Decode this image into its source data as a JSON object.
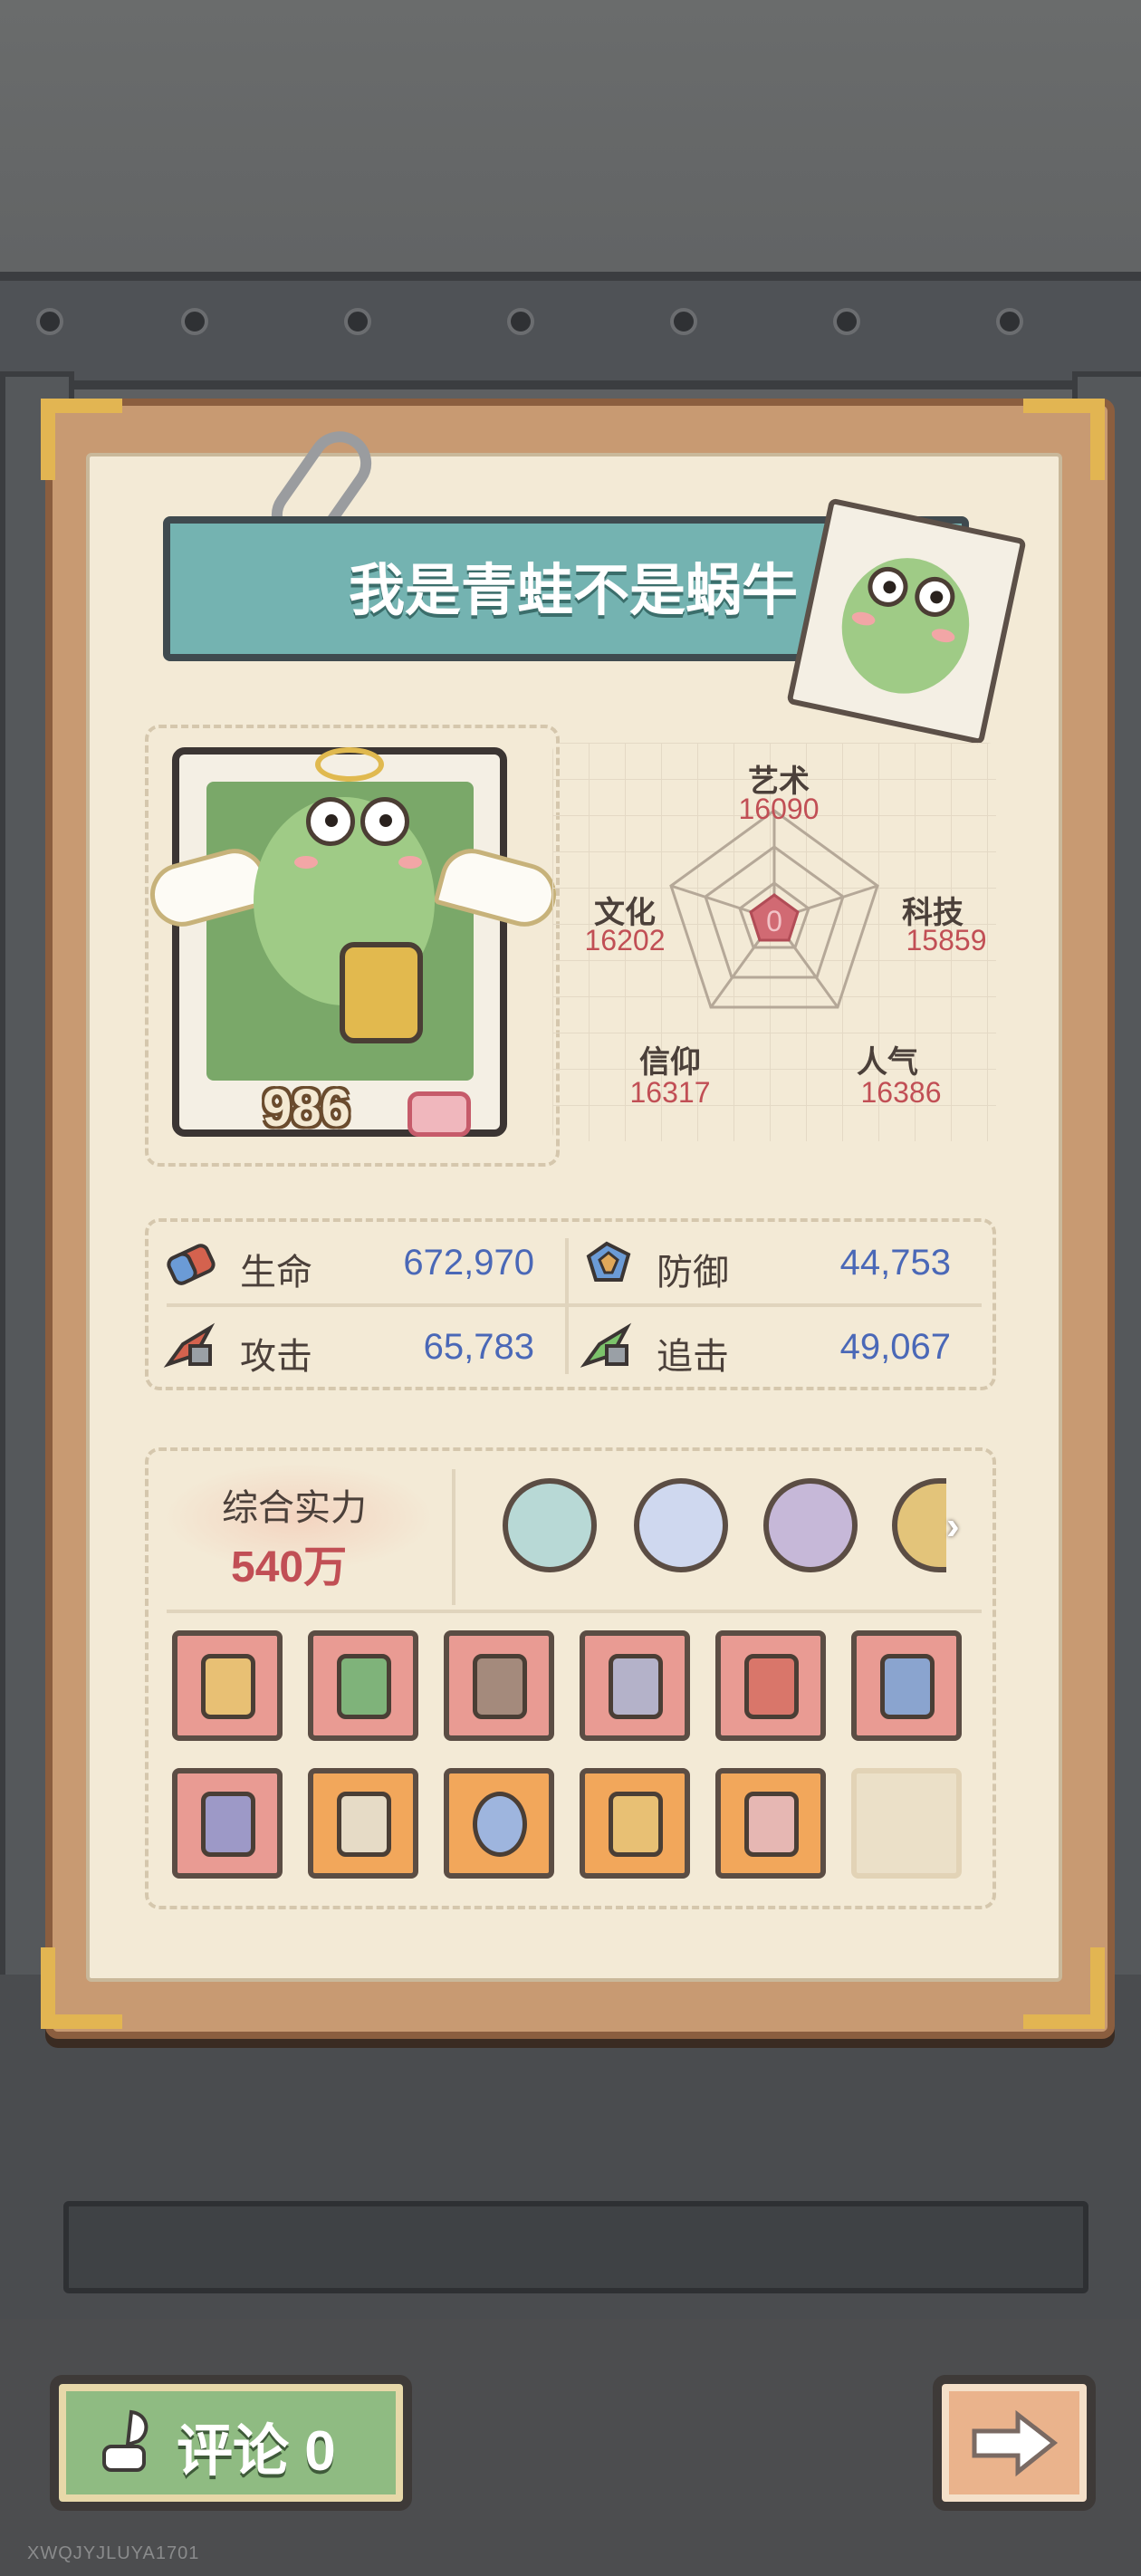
{
  "profile": {
    "name": "我是青蛙不是蜗牛",
    "level": "986"
  },
  "attributes": [
    {
      "name": "艺术",
      "value": "16090"
    },
    {
      "name": "文化",
      "value": "16202"
    },
    {
      "name": "科技",
      "value": "15859"
    },
    {
      "name": "信仰",
      "value": "16317"
    },
    {
      "name": "人气",
      "value": "16386"
    }
  ],
  "radar_center": "0",
  "stats": {
    "hp": {
      "label": "生命",
      "value": "672,970"
    },
    "defense": {
      "label": "防御",
      "value": "44,753"
    },
    "attack": {
      "label": "攻击",
      "value": "65,783"
    },
    "pursuit": {
      "label": "追击",
      "value": "49,067"
    }
  },
  "power": {
    "label": "综合实力",
    "value": "540万"
  },
  "badges": [
    "cake-badge",
    "skull-badge",
    "scroll-badge",
    "globe-badge"
  ],
  "equipment": [
    {
      "icon": "scepter",
      "rarity": "red"
    },
    {
      "icon": "serpent-staff",
      "rarity": "red"
    },
    {
      "icon": "robot-chest",
      "rarity": "red"
    },
    {
      "icon": "cloak",
      "rarity": "red"
    },
    {
      "icon": "flame-sword",
      "rarity": "red"
    },
    {
      "icon": "crossbow",
      "rarity": "red"
    },
    {
      "icon": "crystal-gauntlet",
      "rarity": "red"
    },
    {
      "icon": "mummy-armor",
      "rarity": "orange"
    },
    {
      "icon": "ring",
      "rarity": "orange"
    },
    {
      "icon": "bracelet",
      "rarity": "orange"
    },
    {
      "icon": "vest",
      "rarity": "orange"
    },
    {
      "icon": "",
      "rarity": "empty"
    }
  ],
  "comment": {
    "label": "评论",
    "count": "0"
  },
  "watermark": "XWQJYJLUYA1701",
  "colors": {
    "accent_red": "#c14f55",
    "stat_blue": "#4a68b7",
    "title_teal": "#74b3b1",
    "slot_red": "#e99b93",
    "slot_orange": "#f2a75b"
  }
}
